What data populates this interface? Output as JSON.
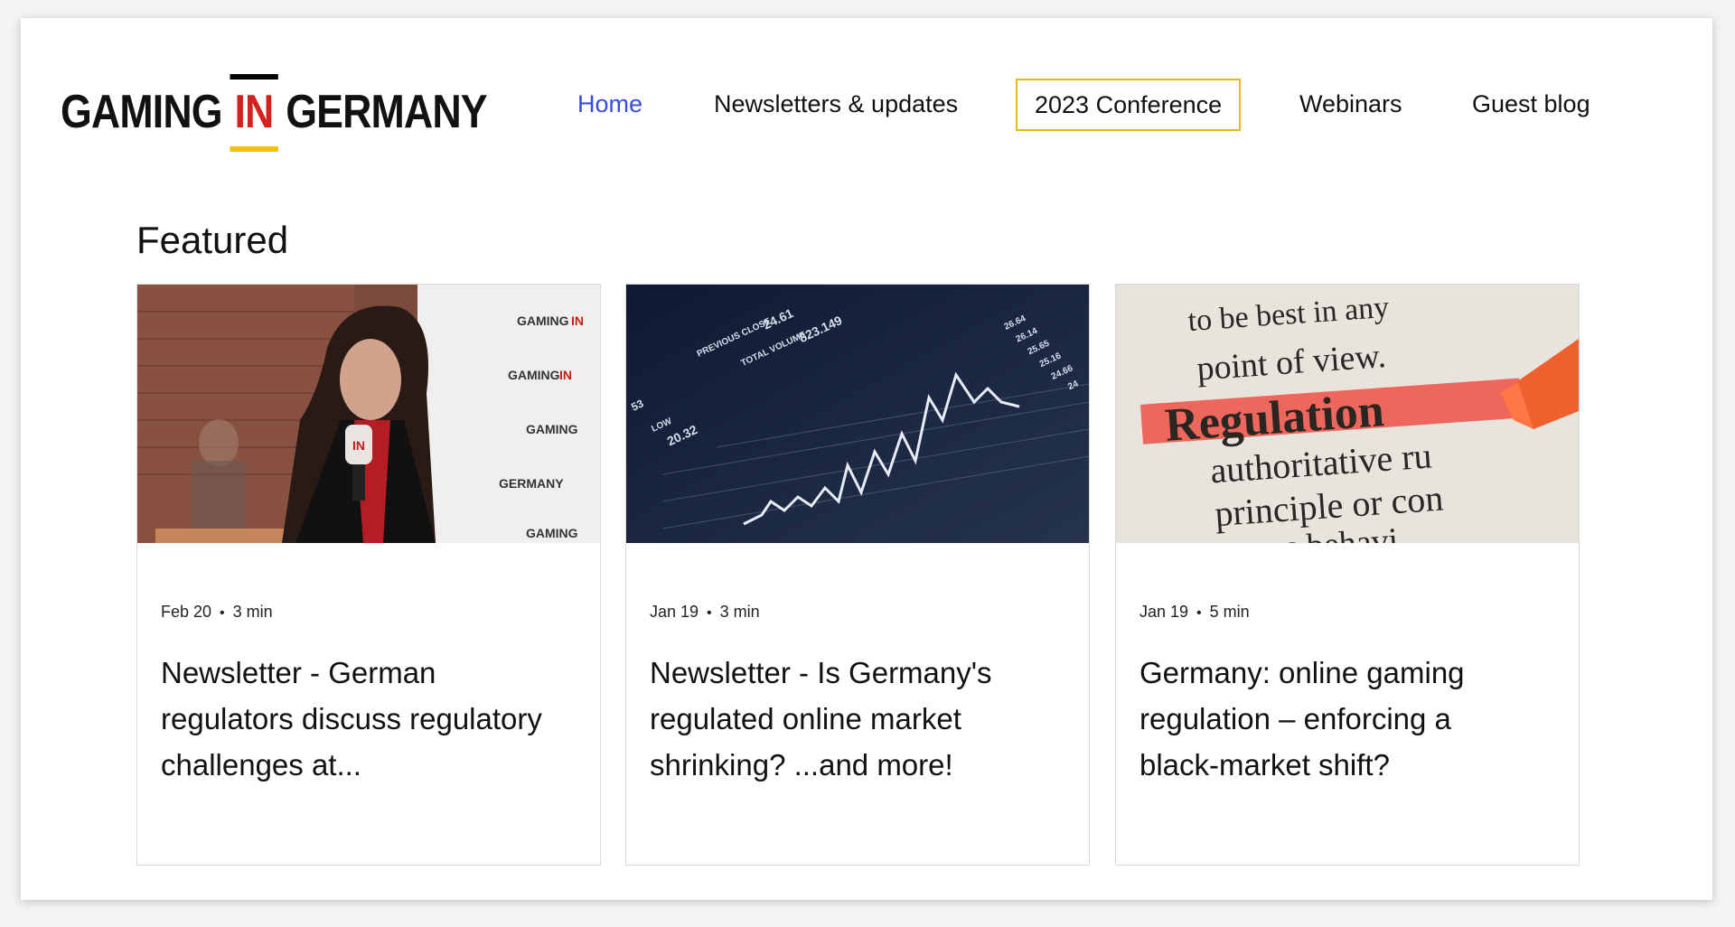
{
  "header": {
    "logo": {
      "word1": "GAMING",
      "word2": "IN",
      "word3": "GERMANY"
    },
    "nav": [
      {
        "label": "Home",
        "state": "active"
      },
      {
        "label": "Newsletters & updates",
        "state": ""
      },
      {
        "label": "2023 Conference",
        "state": "highlighted"
      },
      {
        "label": "Webinars",
        "state": ""
      },
      {
        "label": "Guest blog",
        "state": ""
      }
    ]
  },
  "featured": {
    "title": "Featured",
    "posts": [
      {
        "date": "Feb 20",
        "read_time": "3 min",
        "title": "Newsletter - German regulators discuss regulatory challenges at...",
        "image": "speaker-at-podium-photo",
        "image_text": [
          "GAMING IN GERMANY",
          "IN"
        ]
      },
      {
        "date": "Jan 19",
        "read_time": "3 min",
        "title": "Newsletter - Is Germany's regulated online market shrinking? ...and more!",
        "image": "stock-chart-screen-photo",
        "image_text": [
          "PREVIOUS CLOSE",
          "24.61",
          "TOTAL VOLUME",
          "823.149",
          "LOW",
          "20.32",
          "53",
          "26.64",
          "26.14",
          "25.65",
          "25.16",
          "24.66",
          "24"
        ]
      },
      {
        "date": "Jan 19",
        "read_time": "5 min",
        "title": "Germany: online gaming regulation – enforcing a black-market shift?",
        "image": "dictionary-regulation-highlight-photo",
        "image_text": [
          "to be best in any",
          "point of view.",
          "Regulation",
          "authoritative ru",
          "principle or con",
          "verns behavi"
        ]
      }
    ]
  },
  "colors": {
    "nav_active": "#3a4bd6",
    "conference_border": "#e8b91f",
    "logo_red": "#d3211d",
    "logo_yellow": "#f2c200"
  }
}
